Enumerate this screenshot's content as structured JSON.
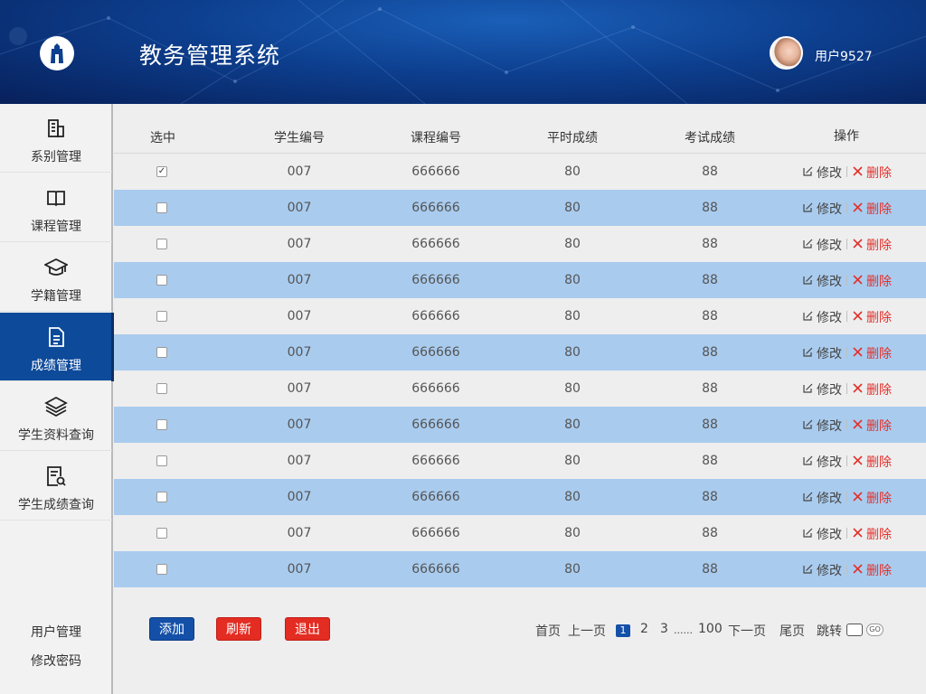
{
  "app": {
    "title": "教务管理系统",
    "username": "用户9527"
  },
  "sidebar": {
    "items": [
      {
        "label": "系别管理"
      },
      {
        "label": "课程管理"
      },
      {
        "label": "学籍管理"
      },
      {
        "label": "成绩管理"
      },
      {
        "label": "学生资料查询"
      },
      {
        "label": "学生成绩查询"
      }
    ],
    "active": "成绩管理",
    "bottom": [
      {
        "label": "用户管理"
      },
      {
        "label": "修改密码"
      }
    ]
  },
  "table": {
    "columns": [
      "选中",
      "学生编号",
      "课程编号",
      "平时成绩",
      "考试成绩",
      "操作"
    ],
    "edit_label": "修改",
    "delete_label": "删除",
    "rows": [
      {
        "checked": true,
        "student_id": "007",
        "course_id": "666666",
        "usual_score": "80",
        "exam_score": "88"
      },
      {
        "checked": false,
        "student_id": "007",
        "course_id": "666666",
        "usual_score": "80",
        "exam_score": "88"
      },
      {
        "checked": false,
        "student_id": "007",
        "course_id": "666666",
        "usual_score": "80",
        "exam_score": "88"
      },
      {
        "checked": false,
        "student_id": "007",
        "course_id": "666666",
        "usual_score": "80",
        "exam_score": "88"
      },
      {
        "checked": false,
        "student_id": "007",
        "course_id": "666666",
        "usual_score": "80",
        "exam_score": "88"
      },
      {
        "checked": false,
        "student_id": "007",
        "course_id": "666666",
        "usual_score": "80",
        "exam_score": "88"
      },
      {
        "checked": false,
        "student_id": "007",
        "course_id": "666666",
        "usual_score": "80",
        "exam_score": "88"
      },
      {
        "checked": false,
        "student_id": "007",
        "course_id": "666666",
        "usual_score": "80",
        "exam_score": "88"
      },
      {
        "checked": false,
        "student_id": "007",
        "course_id": "666666",
        "usual_score": "80",
        "exam_score": "88"
      },
      {
        "checked": false,
        "student_id": "007",
        "course_id": "666666",
        "usual_score": "80",
        "exam_score": "88"
      },
      {
        "checked": false,
        "student_id": "007",
        "course_id": "666666",
        "usual_score": "80",
        "exam_score": "88"
      },
      {
        "checked": false,
        "student_id": "007",
        "course_id": "666666",
        "usual_score": "80",
        "exam_score": "88"
      }
    ]
  },
  "actions": {
    "add": "添加",
    "refresh": "刷新",
    "exit": "退出"
  },
  "pagination": {
    "first": "首页",
    "prev": "上一页",
    "current": "1",
    "page2": "2",
    "page3": "3",
    "ellipsis": "......",
    "last_page": "100",
    "next": "下一页",
    "end": "尾页",
    "jump": "跳转",
    "go": "GO"
  },
  "colors": {
    "header": "#0d3f8f",
    "active_nav": "#0d4a9a",
    "row_alt": "#a9cbee",
    "delete": "#e2312c",
    "btn_blue": "#1450a8",
    "btn_red": "#e32c22"
  }
}
